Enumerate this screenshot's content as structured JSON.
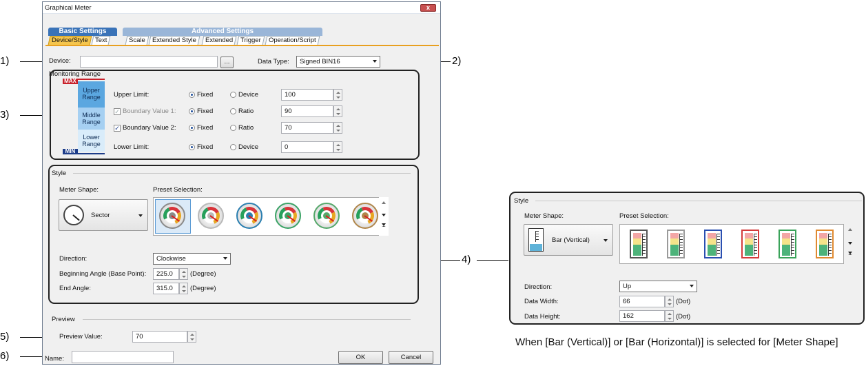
{
  "dialog": {
    "title": "Graphical Meter",
    "close_label": "x",
    "top_tabs": {
      "basic": "Basic Settings",
      "advanced": "Advanced Settings"
    },
    "tabs": [
      "Device/Style",
      "Text",
      "Scale",
      "Extended Style",
      "Extended",
      "Trigger",
      "Operation/Script"
    ],
    "device": {
      "label": "Device:",
      "value": "",
      "browse": "..."
    },
    "data_type": {
      "label": "Data Type:",
      "value": "Signed BIN16"
    },
    "monitoring": {
      "title": "Monitoring Range",
      "max": "MAX",
      "min": "MIN",
      "ranges": [
        "Upper Range",
        "Middle Range",
        "Lower Range"
      ],
      "rows": [
        {
          "label": "Upper Limit:",
          "checkbox": false,
          "checked": false,
          "opt1": "Fixed",
          "opt2": "Device",
          "value": "100"
        },
        {
          "label": "Boundary Value 1:",
          "checkbox": true,
          "checked": true,
          "disabled": true,
          "opt1": "Fixed",
          "opt2": "Ratio",
          "value": "90"
        },
        {
          "label": "Boundary Value 2:",
          "checkbox": true,
          "checked": true,
          "opt1": "Fixed",
          "opt2": "Ratio",
          "value": "70"
        },
        {
          "label": "Lower Limit:",
          "checkbox": false,
          "checked": false,
          "opt1": "Fixed",
          "opt2": "Device",
          "value": "0"
        }
      ]
    },
    "style": {
      "title": "Style",
      "meter_shape_label": "Meter Shape:",
      "meter_shape_value": "Sector",
      "preset_label": "Preset Selection:",
      "presets": [
        "#8a8a8a",
        "#b9b9b9",
        "#2b7fb0",
        "#3ba366",
        "#55a86a",
        "#b0864a"
      ],
      "direction_label": "Direction:",
      "direction_value": "Clockwise",
      "begin_label": "Beginning Angle (Base Point):",
      "begin_value": "225.0",
      "begin_unit": "(Degree)",
      "end_label": "End Angle:",
      "end_value": "315.0",
      "end_unit": "(Degree)"
    },
    "preview": {
      "title": "Preview",
      "label": "Preview Value:",
      "value": "70"
    },
    "name": {
      "label": "Name:",
      "value": ""
    },
    "ok": "OK",
    "cancel": "Cancel"
  },
  "alt_style": {
    "title": "Style",
    "meter_shape_label": "Meter Shape:",
    "meter_shape_value": "Bar (Vertical)",
    "preset_label": "Preset Selection:",
    "presets": [
      "#555555",
      "#9a9a9a",
      "#2a4fb0",
      "#d43b3b",
      "#3aa35a",
      "#e08a30"
    ],
    "direction_label": "Direction:",
    "direction_value": "Up",
    "width_label": "Data Width:",
    "width_value": "66",
    "width_unit": "(Dot)",
    "height_label": "Data Height:",
    "height_value": "162",
    "height_unit": "(Dot)",
    "caption": "When [Bar (Vertical)] or [Bar (Horizontal)] is selected for [Meter Shape]"
  },
  "callouts": [
    "1)",
    "2)",
    "3)",
    "4)",
    "5)",
    "6)"
  ]
}
